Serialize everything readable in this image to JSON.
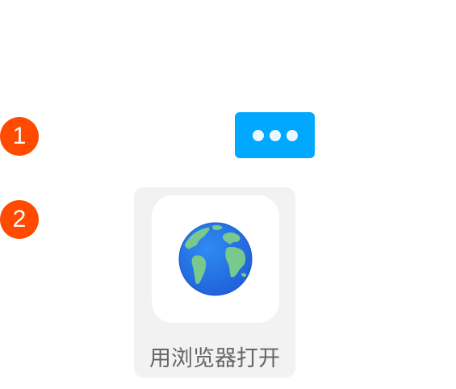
{
  "steps": [
    {
      "number": "1"
    },
    {
      "number": "2"
    }
  ],
  "more_button": {
    "icon": "ellipsis-icon",
    "color": "#00a9ff"
  },
  "share_tile": {
    "icon": "globe-icon",
    "label": "用浏览器打开"
  },
  "colors": {
    "step_badge": "#ff4a00",
    "tile_background": "#f2f2f2",
    "label_text": "#666666"
  }
}
